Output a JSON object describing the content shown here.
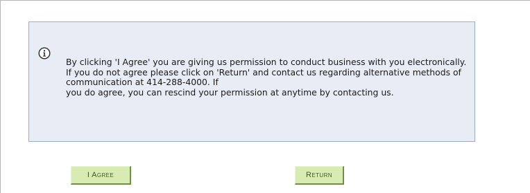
{
  "notice": {
    "icon": "info-icon",
    "lines": [
      "By clicking 'I Agree' you are giving us permission to conduct business with you electronically.",
      "If you do not agree please click on 'Return' and contact us regarding alternative methods of communication at 414-288-4000. If",
      "you do agree, you can rescind your permission at anytime by contacting us."
    ]
  },
  "buttons": {
    "agree_label": "I Agree",
    "return_label": "Return"
  },
  "colors": {
    "notice_background": "#e7ecf5",
    "notice_border": "#9aaed3",
    "button_background": "#d7ebb3",
    "button_text": "#3c5a1e"
  }
}
